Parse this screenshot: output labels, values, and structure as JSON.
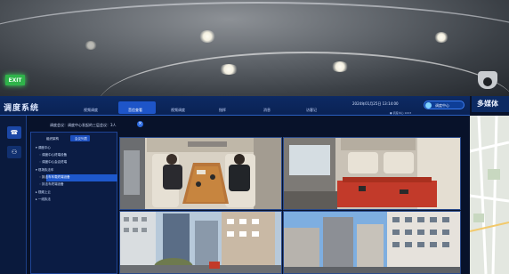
{
  "header": {
    "system_title": "调度系统",
    "nav_tabs": [
      "视频调度",
      "音信查看",
      "视频调度",
      "指挥",
      "消息",
      "访客记"
    ],
    "active_tab_index": 1,
    "datetime": "2024年01月25日 13:14:00",
    "user_label": "调度中心",
    "sub_info": "● 调度中心 1003",
    "right_panel_title": "多媒体"
  },
  "info_bar": {
    "label": "调度会议：调度中心发起的三层会议：3人",
    "close_icon": "close-icon"
  },
  "left_strip": {
    "buttons": [
      "phone-icon",
      "user-icon"
    ]
  },
  "tree_panel": {
    "tabs": [
      "组织架构",
      "会议列表"
    ],
    "items": [
      "▾ 调度中心",
      "  ◦ 调度中心终端设备",
      "  ◦ 调度中心会议终端",
      "▾ 现场执法车",
      "  ◦ 执法车车载终端设备",
      "  ◦ 执法车终端设备",
      "▸ 视频上云",
      "▸ 一线执法"
    ],
    "selected_index": 4
  },
  "video_grid": {
    "tiles": [
      "vehicle-interior-people",
      "vehicle-interior-empty",
      "street-view-buildings",
      "street-view-apartments"
    ]
  },
  "room": {
    "exit_sign": "EXIT"
  },
  "colors": {
    "accent": "#1e55c8",
    "topbar": "#0d2a63",
    "panel": "#0b1c44"
  }
}
